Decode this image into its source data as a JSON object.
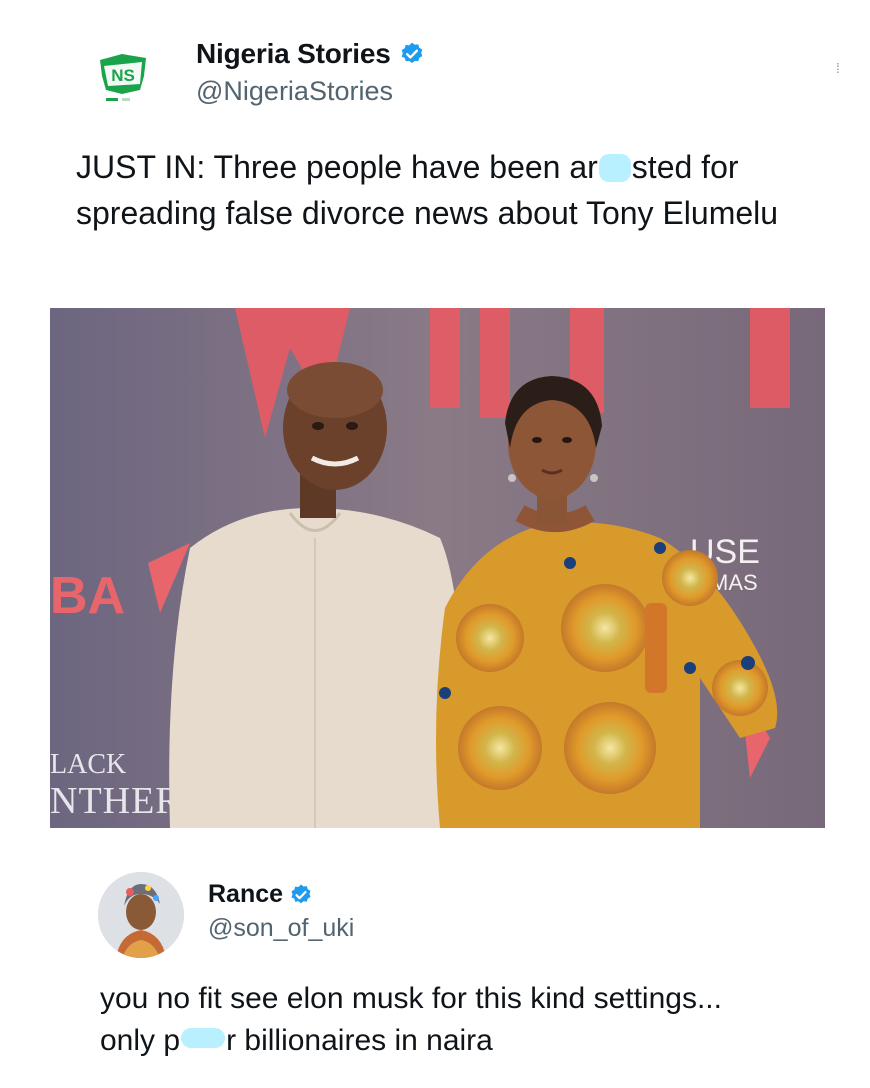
{
  "post": {
    "display_name": "Nigeria Stories",
    "handle": "@NigeriaStories",
    "avatar_text": "NS",
    "verified_icon": "verified-badge-icon",
    "text_part1": "JUST IN: Three people have been ar",
    "text_part2": "sted for spreading false divorce news about Tony Elumelu",
    "photo_sign_text_1": "BA",
    "photo_sign_text_2": "USE",
    "photo_sign_text_3": "MAS",
    "photo_sign_text_4": "LACK",
    "photo_sign_text_5": "NTHER"
  },
  "reply": {
    "display_name": "Rance",
    "handle": "@son_of_uki",
    "text_line1": "you no fit see elon musk for this kind settings...",
    "text_part2a": "only p",
    "text_part2b": "r billionaires in naira"
  },
  "colors": {
    "verified": "#1d9bf0",
    "handle": "#536471",
    "censor_blur": "#b9f0ff"
  }
}
